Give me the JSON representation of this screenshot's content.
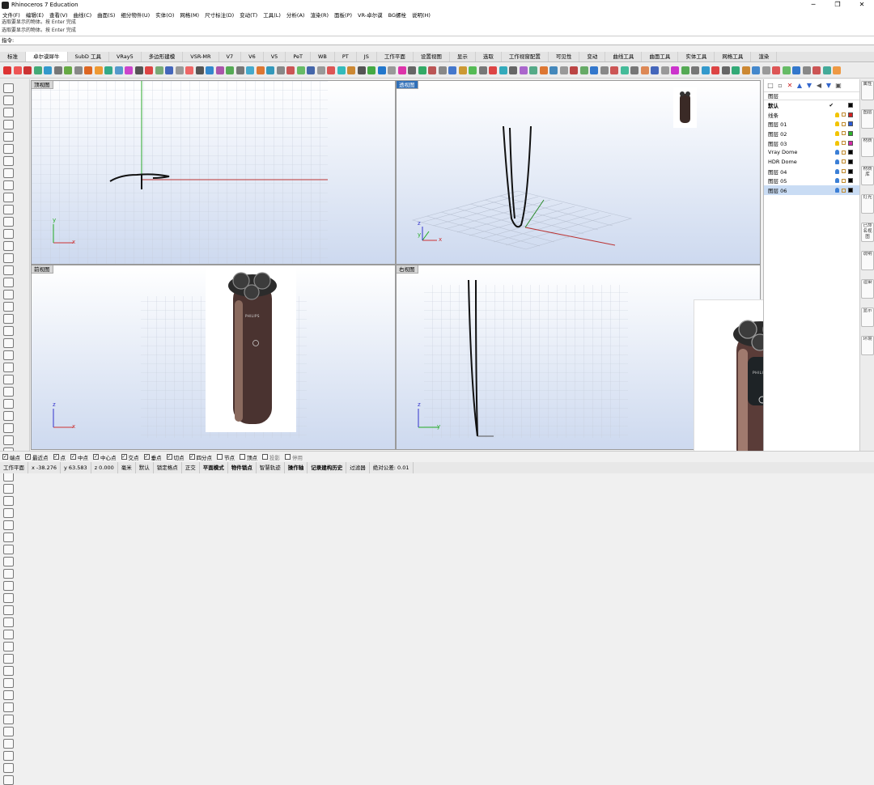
{
  "window": {
    "title": "Rhinoceros 7 Education",
    "controls": [
      "─",
      "❐",
      "✕"
    ]
  },
  "menu": [
    "文件(F)",
    "编辑(E)",
    "查看(V)",
    "曲线(C)",
    "曲面(S)",
    "细分物件(U)",
    "实体(O)",
    "网格(M)",
    "尺寸标注(D)",
    "变动(T)",
    "工具(L)",
    "分析(A)",
    "渲染(R)",
    "面板(P)",
    "VR-卓尔谟",
    "BG螺栓",
    "说明(H)"
  ],
  "command_history": [
    "选取要显示的物体。按 Enter 完成",
    "选取要显示的物体。按 Enter 完成"
  ],
  "command_prompt": "指令:",
  "tabs": [
    "标准",
    "卓尔谟犀牛",
    "SubD 工具",
    "VRay5",
    "多边形建模",
    "VSR-MR",
    "V7",
    "V6",
    "V5",
    "PeT",
    "WB",
    "PT",
    "JS",
    "工作平面",
    "设置视图",
    "显示",
    "选取",
    "工作视窗配置",
    "可见性",
    "变动",
    "曲线工具",
    "曲面工具",
    "实体工具",
    "网格工具",
    "渲染"
  ],
  "active_tab": "卓尔谟犀牛",
  "viewports": {
    "top": {
      "label": "顶视图",
      "axis_x": "x",
      "axis_y": "y"
    },
    "perspective": {
      "label": "透视图",
      "axis_x": "x",
      "axis_y": "y",
      "axis_z": "z"
    },
    "front": {
      "label": "前视图",
      "axis_x": "x",
      "axis_z": "z"
    },
    "right": {
      "label": "右视图",
      "axis_y": "y",
      "axis_z": "z"
    }
  },
  "photo_text": {
    "brand": "PHILIPS"
  },
  "layers_panel": {
    "header": "图层",
    "layers": [
      {
        "name": "默认",
        "current": true,
        "color": "#000000"
      },
      {
        "name": "线条",
        "color": "#d42020"
      },
      {
        "name": "图层 01",
        "color": "#2a5ad6"
      },
      {
        "name": "图层 02",
        "color": "#2bb52b"
      },
      {
        "name": "图层 03",
        "color": "#d629a8"
      },
      {
        "name": "Vray Dome",
        "color": "#000000"
      },
      {
        "name": "HDR Dome",
        "color": "#000000"
      },
      {
        "name": "图层 04",
        "color": "#000000"
      },
      {
        "name": "图层 05",
        "color": "#000000"
      },
      {
        "name": "图层 06",
        "color": "#000000",
        "selected": true
      }
    ]
  },
  "side_tabs": [
    "属性",
    "图层",
    "材质",
    "材质库",
    "灯光",
    "已命名视图",
    "说明",
    "渲染",
    "显示",
    "环境"
  ],
  "osnaps": [
    {
      "label": "端点",
      "checked": true
    },
    {
      "label": "最近点",
      "checked": true
    },
    {
      "label": "点",
      "checked": true
    },
    {
      "label": "中点",
      "checked": true
    },
    {
      "label": "中心点",
      "checked": true
    },
    {
      "label": "交点",
      "checked": true
    },
    {
      "label": "垂点",
      "checked": true
    },
    {
      "label": "切点",
      "checked": true
    },
    {
      "label": "四分点",
      "checked": true
    },
    {
      "label": "节点",
      "checked": false
    },
    {
      "label": "顶点",
      "checked": false
    },
    {
      "label": "投影",
      "checked": false
    },
    {
      "label": "停用",
      "checked": false
    }
  ],
  "status": {
    "cplane": "工作平面",
    "x": "x -38.276",
    "y": "y 63.583",
    "z": "z 0.000",
    "units": "毫米",
    "layer": "默认",
    "toggles": [
      "锁定格点",
      "正交",
      "平面模式",
      "物件锁点",
      "智慧轨迹",
      "操作轴",
      "记录建构历史",
      "过滤器"
    ],
    "tolerance": "绝对公差: 0.01"
  }
}
